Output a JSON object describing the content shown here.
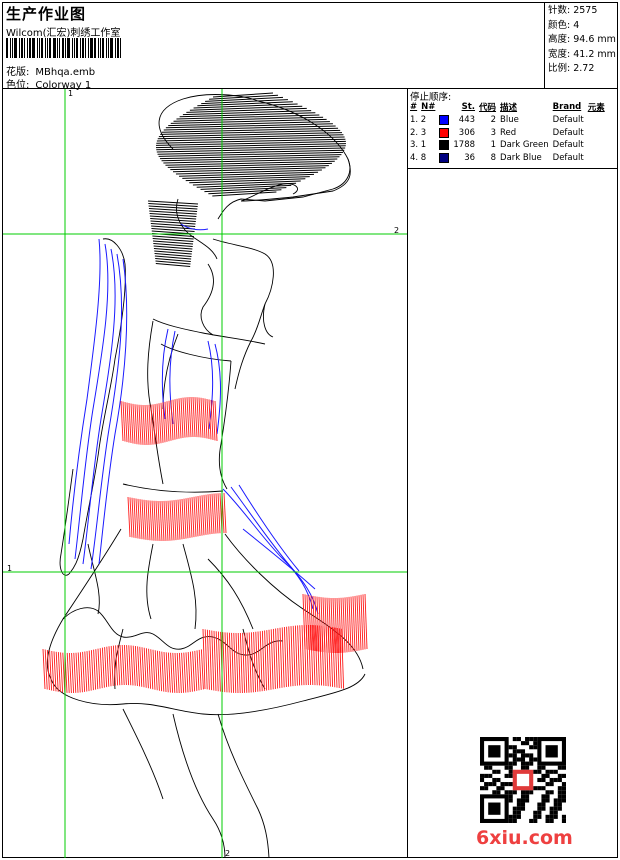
{
  "header": {
    "title": "生产作业图",
    "company": "Wilcom(汇宏)刺绣工作室",
    "design_label": "花版:",
    "design_value": "MBhqa.emb",
    "colorway_label": "色位:",
    "colorway_value": "Colorway 1"
  },
  "stats": {
    "stitches": "针数: 2575",
    "colors": "颜色: 4",
    "height": "高度: 94.6 mm",
    "width": "宽度: 41.2 mm",
    "ratio": "比例: 2.72"
  },
  "legend": {
    "title": "停止顺序:",
    "columns": [
      "#",
      "N#",
      "St.",
      "代码",
      "描述",
      "Brand",
      "元素"
    ],
    "rows": [
      {
        "idx": "1. 2",
        "color": "#0000ff",
        "st": "443",
        "code": "2",
        "desc": "Blue",
        "brand": "Default"
      },
      {
        "idx": "2. 3",
        "color": "#ff0000",
        "st": "306",
        "code": "3",
        "desc": "Red",
        "brand": "Default"
      },
      {
        "idx": "3. 1",
        "color": "#000000",
        "st": "1788",
        "code": "1",
        "desc": "Dark Green",
        "brand": "Default"
      },
      {
        "idx": "4. 8",
        "color": "#000080",
        "st": "36",
        "code": "8",
        "desc": "Dark Blue",
        "brand": "Default"
      }
    ]
  },
  "guides": {
    "v1": "1",
    "v2": "2",
    "h1": "1",
    "h2": "2"
  },
  "thread_colors": {
    "blue": "#1a1aff",
    "red": "#ff1a1a",
    "black": "#000000",
    "guide": "#00cc00"
  },
  "watermark": "6xiu.com"
}
